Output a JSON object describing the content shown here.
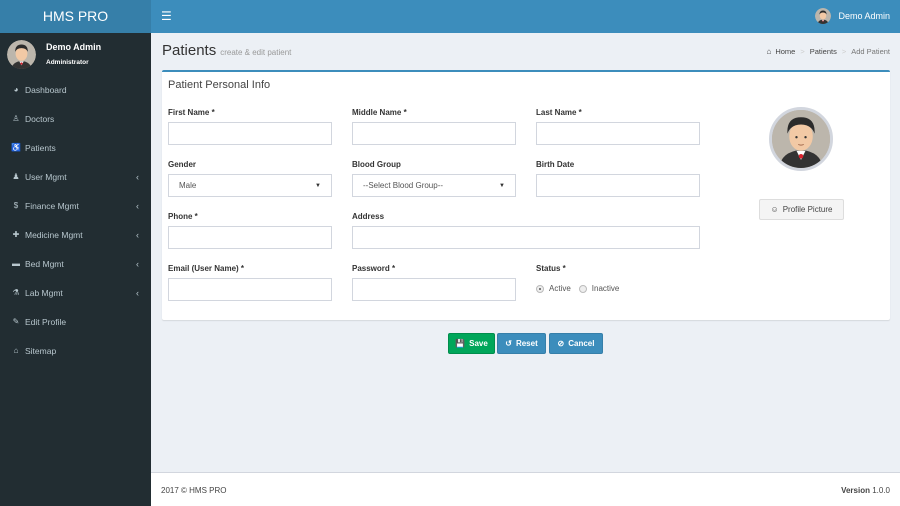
{
  "app": {
    "logo_text": "HMS PRO",
    "menu_toggle_icon": "hamburger-icon"
  },
  "topbar": {
    "user_name": "Demo Admin",
    "avatar_icon": "user-avatar-icon"
  },
  "sidebar": {
    "user": {
      "name": "Demo Admin",
      "role": "Administrator"
    },
    "items": [
      {
        "label": "Dashboard",
        "icon": "dashboard-icon",
        "glyph": "◕",
        "has_submenu": false
      },
      {
        "label": "Doctors",
        "icon": "user-md-icon",
        "glyph": "♙",
        "has_submenu": false
      },
      {
        "label": "Patients",
        "icon": "wheelchair-icon",
        "glyph": "♿",
        "has_submenu": false
      },
      {
        "label": "User Mgmt",
        "icon": "user-icon",
        "glyph": "♟",
        "has_submenu": true
      },
      {
        "label": "Finance Mgmt",
        "icon": "dollar-icon",
        "glyph": "$",
        "has_submenu": true
      },
      {
        "label": "Medicine Mgmt",
        "icon": "medkit-icon",
        "glyph": "✚",
        "has_submenu": true
      },
      {
        "label": "Bed Mgmt",
        "icon": "bed-icon",
        "glyph": "▬",
        "has_submenu": true
      },
      {
        "label": "Lab Mgmt",
        "icon": "flask-icon",
        "glyph": "⚗",
        "has_submenu": true
      },
      {
        "label": "Edit Profile",
        "icon": "edit-icon",
        "glyph": "✎",
        "has_submenu": false
      },
      {
        "label": "Sitemap",
        "icon": "home-icon",
        "glyph": "⌂",
        "has_submenu": false
      }
    ],
    "submenu_glyph": "‹"
  },
  "header": {
    "title": "Patients",
    "subtitle": "create & edit patient",
    "breadcrumb": [
      {
        "label": "Home",
        "icon": "home-icon"
      },
      {
        "label": "Patients"
      },
      {
        "label": "Add Patient"
      }
    ],
    "breadcrumb_sep": ">"
  },
  "form": {
    "title": "Patient Personal Info",
    "fields": {
      "first_name": {
        "label": "First Name *",
        "value": ""
      },
      "middle_name": {
        "label": "Middle Name *",
        "value": ""
      },
      "last_name": {
        "label": "Last Name *",
        "value": ""
      },
      "gender": {
        "label": "Gender",
        "value": "Male"
      },
      "blood_group": {
        "label": "Blood Group",
        "value": "--Select Blood Group--"
      },
      "birth_date": {
        "label": "Birth Date",
        "value": ""
      },
      "phone": {
        "label": "Phone *",
        "value": ""
      },
      "address": {
        "label": "Address",
        "value": ""
      },
      "email": {
        "label": "Email (User Name) *",
        "value": ""
      },
      "password": {
        "label": "Password *",
        "value": ""
      },
      "status": {
        "label": "Status *",
        "options": [
          "Active",
          "Inactive"
        ],
        "selected": "Active"
      }
    },
    "profile_picture_button": "Profile Picture"
  },
  "actions": {
    "save": "Save",
    "reset": "Reset",
    "cancel": "Cancel"
  },
  "colors": {
    "primary": "#3c8dbc",
    "logo_bg": "#367fa9",
    "sidebar_bg": "#222d32",
    "success": "#00a65a"
  },
  "footer": {
    "copyright": "2017 © HMS PRO",
    "version_label": "Version",
    "version_number": "1.0.0"
  }
}
